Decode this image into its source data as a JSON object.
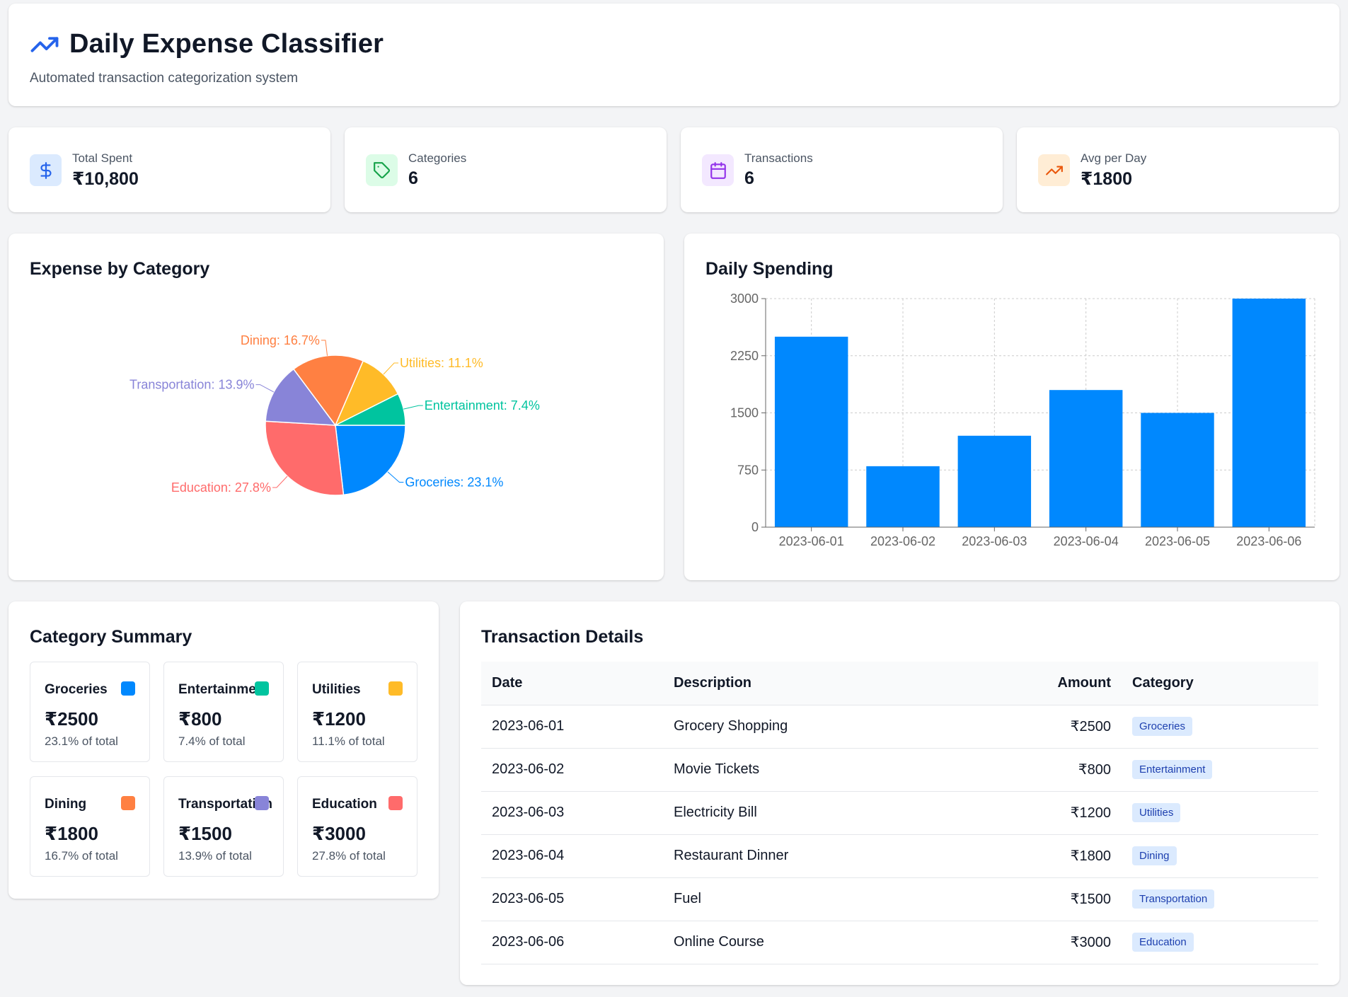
{
  "header": {
    "title": "Daily Expense Classifier",
    "subtitle": "Automated transaction categorization system"
  },
  "stats": [
    {
      "label": "Total Spent",
      "value": "₹10,800",
      "icon": "dollar-icon",
      "bg": "#dbeafe",
      "fg": "#2563eb"
    },
    {
      "label": "Categories",
      "value": "6",
      "icon": "tag-icon",
      "bg": "#dcfce7",
      "fg": "#16a34a"
    },
    {
      "label": "Transactions",
      "value": "6",
      "icon": "calendar-icon",
      "bg": "#f3e8ff",
      "fg": "#9333ea"
    },
    {
      "label": "Avg per Day",
      "value": "₹1800",
      "icon": "trending-up-icon",
      "bg": "#ffedd5",
      "fg": "#ea580c"
    }
  ],
  "pie_section": {
    "title": "Expense by Category"
  },
  "bar_section": {
    "title": "Daily Spending"
  },
  "chart_data": [
    {
      "type": "pie",
      "title": "Expense by Category",
      "labels": [
        "Groceries",
        "Education",
        "Transportation",
        "Dining",
        "Utilities",
        "Entertainment"
      ],
      "values": [
        2500,
        3000,
        1500,
        1800,
        1200,
        800
      ],
      "percent_labels": [
        "Groceries: 23.1%",
        "Education: 27.8%",
        "Transportation: 13.9%",
        "Dining: 16.7%",
        "Utilities: 11.1%",
        "Entertainment: 7.4%"
      ],
      "colors": [
        "#0088fe",
        "#ff6b6b",
        "#8884d8",
        "#ff8042",
        "#ffbb28",
        "#00c49f"
      ]
    },
    {
      "type": "bar",
      "title": "Daily Spending",
      "categories": [
        "2023-06-01",
        "2023-06-02",
        "2023-06-03",
        "2023-06-04",
        "2023-06-05",
        "2023-06-06"
      ],
      "values": [
        2500,
        800,
        1200,
        1800,
        1500,
        3000
      ],
      "yticks": [
        "0",
        "750",
        "1500",
        "2250",
        "3000"
      ],
      "ylim": [
        0,
        3000
      ],
      "grid": true,
      "color": "#0088fe"
    }
  ],
  "summary": {
    "title": "Category Summary",
    "items": [
      {
        "name": "Groceries",
        "amount": "₹2500",
        "pct": "23.1% of total",
        "color": "#0088fe"
      },
      {
        "name": "Entertainment",
        "amount": "₹800",
        "pct": "7.4% of total",
        "color": "#00c49f"
      },
      {
        "name": "Utilities",
        "amount": "₹1200",
        "pct": "11.1% of total",
        "color": "#ffbb28"
      },
      {
        "name": "Dining",
        "amount": "₹1800",
        "pct": "16.7% of total",
        "color": "#ff8042"
      },
      {
        "name": "Transportation",
        "amount": "₹1500",
        "pct": "13.9% of total",
        "color": "#8884d8"
      },
      {
        "name": "Education",
        "amount": "₹3000",
        "pct": "27.8% of total",
        "color": "#ff6b6b"
      }
    ]
  },
  "table": {
    "title": "Transaction Details",
    "headers": {
      "date": "Date",
      "description": "Description",
      "amount": "Amount",
      "category": "Category"
    },
    "rows": [
      {
        "date": "2023-06-01",
        "description": "Grocery Shopping",
        "amount": "₹2500",
        "category": "Groceries"
      },
      {
        "date": "2023-06-02",
        "description": "Movie Tickets",
        "amount": "₹800",
        "category": "Entertainment"
      },
      {
        "date": "2023-06-03",
        "description": "Electricity Bill",
        "amount": "₹1200",
        "category": "Utilities"
      },
      {
        "date": "2023-06-04",
        "description": "Restaurant Dinner",
        "amount": "₹1800",
        "category": "Dining"
      },
      {
        "date": "2023-06-05",
        "description": "Fuel",
        "amount": "₹1500",
        "category": "Transportation"
      },
      {
        "date": "2023-06-06",
        "description": "Online Course",
        "amount": "₹3000",
        "category": "Education"
      }
    ]
  }
}
